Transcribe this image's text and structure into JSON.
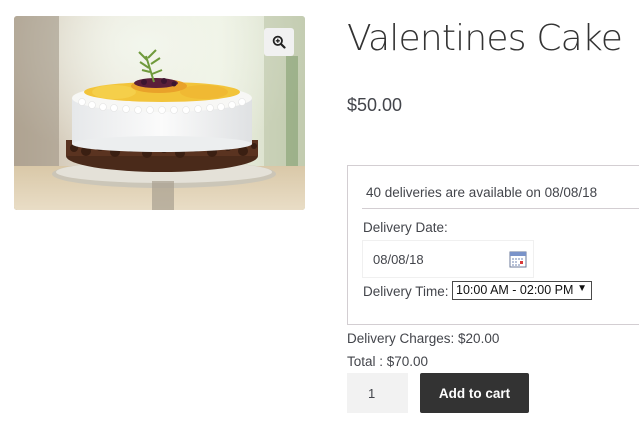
{
  "product": {
    "title": "Valentines Cake",
    "price": "$50.00",
    "image_alt": "cake-photo",
    "zoom_icon": "zoom-in-icon"
  },
  "delivery": {
    "availability": "40 deliveries are available on 08/08/18",
    "date_label": "Delivery Date:",
    "date_value": "08/08/18",
    "calendar_icon": "calendar-icon",
    "time_label": "Delivery Time:",
    "time_value": "10:00 AM - 02:00 PM",
    "time_arrow": "▼"
  },
  "summary": {
    "charges": "Delivery Charges: $20.00",
    "total": "Total : $70.00"
  },
  "cart": {
    "quantity": "1",
    "add_label": "Add to cart"
  },
  "colors": {
    "button_bg": "#333333",
    "border": "#d3ced2",
    "text": "#43454b"
  }
}
